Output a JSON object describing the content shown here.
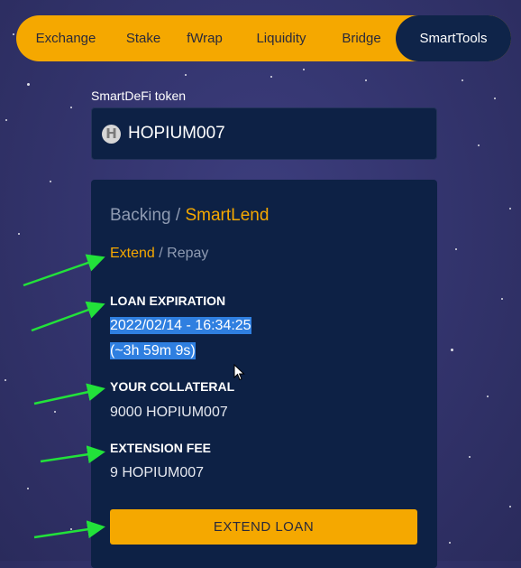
{
  "colors": {
    "accent": "#f5a800",
    "panel": "#0d2145",
    "active_tab": "#0f2449",
    "selection": "#2f7fe0",
    "annotation_arrow": "#22e23a"
  },
  "nav": {
    "items": [
      {
        "label": "Exchange",
        "active": false
      },
      {
        "label": "Stake",
        "active": false
      },
      {
        "label": "fWrap",
        "active": false
      },
      {
        "label": "Liquidity",
        "active": false
      },
      {
        "label": "Bridge",
        "active": false
      },
      {
        "label": "SmartTools",
        "active": true
      }
    ]
  },
  "token": {
    "label": "SmartDeFi token",
    "icon": "h-token-icon",
    "icon_letter": "H",
    "name": "HOPIUM007"
  },
  "card": {
    "heading_muted": "Backing",
    "heading_sep": " / ",
    "heading_active": "SmartLend",
    "subnav_active": "Extend",
    "subnav_sep": " / ",
    "subnav_muted": "Repay",
    "loan_expiration": {
      "title": "LOAN EXPIRATION",
      "date": "2022/02/14 - 16:34:25",
      "remaining": "(~3h 59m 9s)"
    },
    "collateral": {
      "title": "YOUR COLLATERAL",
      "value": "9000 HOPIUM007"
    },
    "extension_fee": {
      "title": "EXTENSION FEE",
      "value": "9 HOPIUM007"
    },
    "button_label": "EXTEND LOAN"
  }
}
